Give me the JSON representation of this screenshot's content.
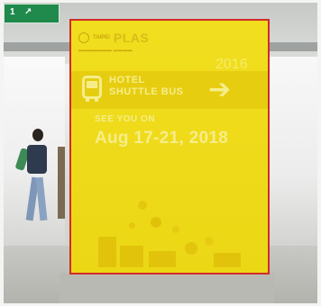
{
  "scene": {
    "green_sign_glyphs": [
      "1",
      "↗"
    ]
  },
  "poster": {
    "logo_brand": "PLAS",
    "logo_prefix": "TAIPEI",
    "year": "2016",
    "shuttle_line1": "HOTEL",
    "shuttle_line2": "SHUTTLE BUS",
    "arrow_glyph": "➔",
    "see_you": "SEE YOU ON",
    "dates": "Aug 17-21, 2018",
    "colors": {
      "background": "#eedb1c",
      "border": "#cf2c2a",
      "text": "#f6ed8a"
    }
  }
}
